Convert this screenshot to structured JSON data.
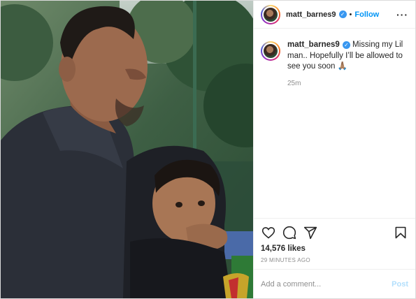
{
  "post": {
    "username": "matt_barnes9",
    "verified": true,
    "follow_label": "Follow",
    "separator": "•",
    "more_icon": "more-options-icon",
    "caption": "Missing my Lil man.. Hopefully I’ll be allowed to see you soon 🙏🏽",
    "caption_time": "25m",
    "likes": "14,576 likes",
    "posted_ago": "29 MINUTES AGO",
    "comment_placeholder": "Add a comment...",
    "post_label": "Post"
  },
  "icons": {
    "like": "heart-icon",
    "comment": "comment-bubble-icon",
    "share": "paper-plane-icon",
    "save": "bookmark-icon"
  },
  "colors": {
    "accent": "#0095f6",
    "verified": "#3897f0",
    "post_disabled": "#b2dffc",
    "muted": "#8e8e8e"
  }
}
